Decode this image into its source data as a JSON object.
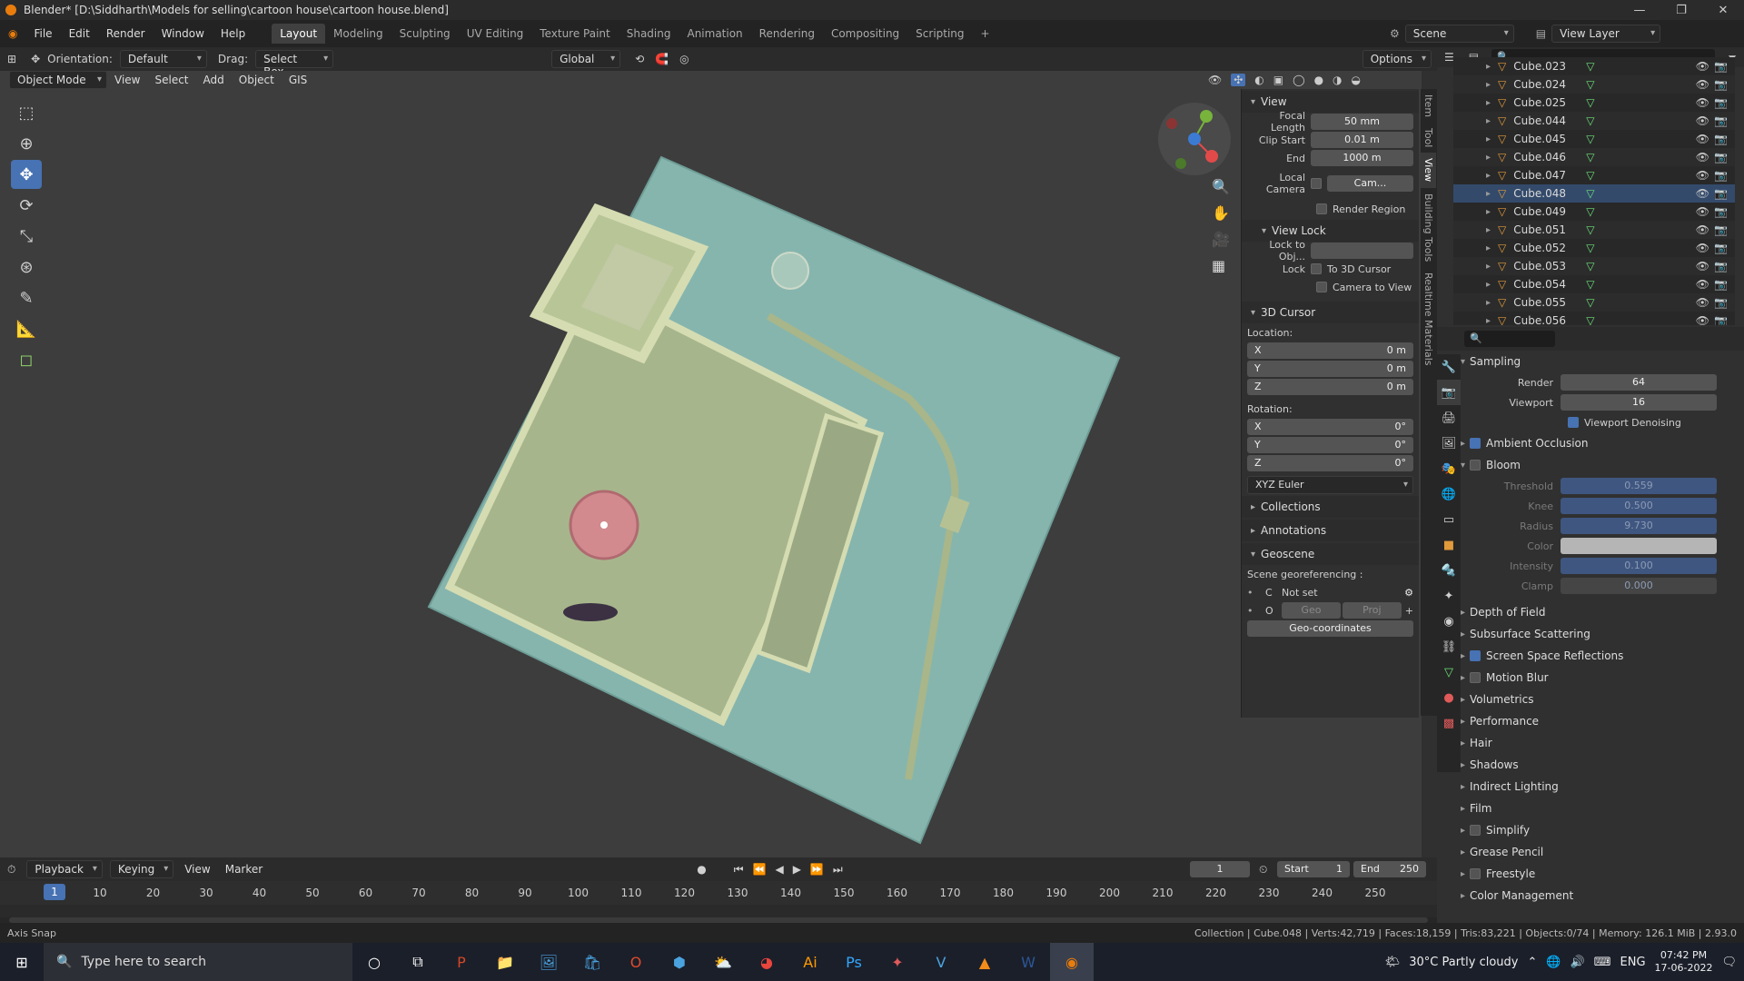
{
  "title": "Blender* [D:\\Siddharth\\Models for selling\\cartoon house\\cartoon house.blend]",
  "menu": [
    "File",
    "Edit",
    "Render",
    "Window",
    "Help"
  ],
  "workspaces": [
    "Layout",
    "Modeling",
    "Sculpting",
    "UV Editing",
    "Texture Paint",
    "Shading",
    "Animation",
    "Rendering",
    "Compositing",
    "Scripting"
  ],
  "scene": "Scene",
  "view_layer": "View Layer",
  "header": {
    "orientation_label": "Orientation:",
    "orientation": "Default",
    "drag_label": "Drag:",
    "drag": "Select Box",
    "transform": "Global",
    "options": "Options"
  },
  "viewport_header": {
    "mode": "Object Mode",
    "view": "View",
    "select": "Select",
    "add": "Add",
    "object": "Object",
    "gis": "GIS"
  },
  "npanel": {
    "view_section": "View",
    "focal_label": "Focal Length",
    "focal": "50 mm",
    "clip_start_label": "Clip Start",
    "clip_start": "0.01 m",
    "end_label": "End",
    "end": "1000 m",
    "local_camera": "Local Camera",
    "camera_field": "Cam...",
    "render_region": "Render Region",
    "view_lock": "View Lock",
    "lock_obj": "Lock to Obj...",
    "lock": "Lock",
    "to_3d_cursor": "To 3D Cursor",
    "camera_to_view": "Camera to View",
    "cursor_section": "3D Cursor",
    "location": "Location:",
    "rotation": "Rotation:",
    "loc": [
      {
        "axis": "X",
        "val": "0 m"
      },
      {
        "axis": "Y",
        "val": "0 m"
      },
      {
        "axis": "Z",
        "val": "0 m"
      }
    ],
    "rot": [
      {
        "axis": "X",
        "val": "0°"
      },
      {
        "axis": "Y",
        "val": "0°"
      },
      {
        "axis": "Z",
        "val": "0°"
      }
    ],
    "euler": "XYZ Euler",
    "collections": "Collections",
    "annotations": "Annotations",
    "geoscene": "Geoscene",
    "georef": "Scene georeferencing :",
    "c": "C",
    "not_set": "Not set",
    "o": "O",
    "geo": "Geo",
    "proj": "Proj",
    "geocoords": "Geo-coordinates"
  },
  "vtabs": [
    "Item",
    "Tool",
    "View",
    "Building Tools",
    "Realtime Materials"
  ],
  "outliner": [
    "Cube.023",
    "Cube.024",
    "Cube.025",
    "Cube.044",
    "Cube.045",
    "Cube.046",
    "Cube.047",
    "Cube.048",
    "Cube.049",
    "Cube.051",
    "Cube.052",
    "Cube.053",
    "Cube.054",
    "Cube.055",
    "Cube.056"
  ],
  "props": {
    "sampling": "Sampling",
    "render_label": "Render",
    "render": "64",
    "viewport_label": "Viewport",
    "viewport": "16",
    "denoise": "Viewport Denoising",
    "ao": "Ambient Occlusion",
    "bloom": "Bloom",
    "bloom_fields": [
      {
        "label": "Threshold",
        "val": "0.559"
      },
      {
        "label": "Knee",
        "val": "0.500"
      },
      {
        "label": "Radius",
        "val": "9.730"
      },
      {
        "label": "Color",
        "val": ""
      },
      {
        "label": "Intensity",
        "val": "0.100"
      },
      {
        "label": "Clamp",
        "val": "0.000"
      }
    ],
    "rest": [
      "Depth of Field",
      "Subsurface Scattering",
      "Screen Space Reflections",
      "Motion Blur",
      "Volumetrics",
      "Performance",
      "Hair",
      "Shadows",
      "Indirect Lighting",
      "Film",
      "Simplify",
      "Grease Pencil",
      "Freestyle",
      "Color Management"
    ]
  },
  "timeline": {
    "playback": "Playback",
    "keying": "Keying",
    "view": "View",
    "marker": "Marker",
    "current": "1",
    "start_label": "Start",
    "start": "1",
    "end_label": "End",
    "end": "250",
    "frames": [
      "10",
      "20",
      "30",
      "40",
      "50",
      "60",
      "70",
      "80",
      "90",
      "100",
      "110",
      "120",
      "130",
      "140",
      "150",
      "160",
      "170",
      "180",
      "190",
      "200",
      "210",
      "220",
      "230",
      "240",
      "250"
    ],
    "playhead": "1"
  },
  "status": {
    "left": "Axis Snap",
    "right": "Collection | Cube.048 | Verts:42,719 | Faces:18,159 | Tris:83,221 | Objects:0/74 | Memory: 126.1 MiB | 2.93.0"
  },
  "taskbar": {
    "search": "Type here to search",
    "weather": "30°C  Partly cloudy",
    "lang": "ENG",
    "time": "07:42 PM",
    "date": "17-06-2022"
  }
}
